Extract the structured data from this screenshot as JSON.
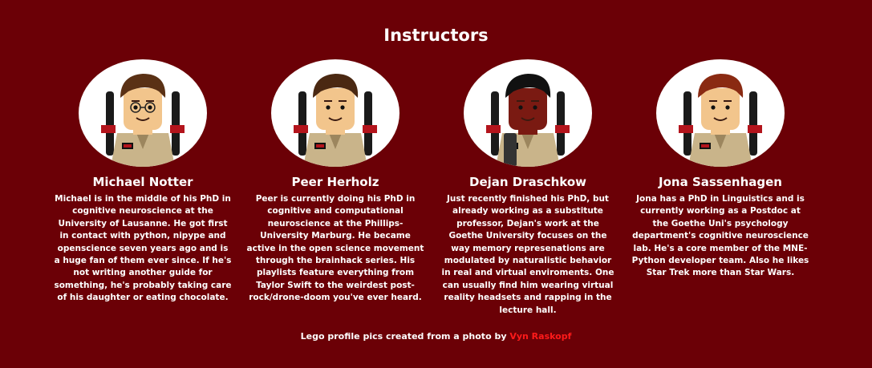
{
  "section": {
    "title": "Instructors"
  },
  "instructors": [
    {
      "name": "Michael Notter",
      "bio": "Michael is in the middle of his PhD in cognitive neuroscience at the University of Lausanne. He got first in contact with python, nipype and openscience seven years ago and is a huge fan of them ever since. If he's not writing another guide for something, he's probably taking care of his daughter or eating chocolate.",
      "avatar_icon": "lego-ghostbuster-glasses-avatar",
      "skin": "#f2c58c",
      "hair": "#5a3115"
    },
    {
      "name": "Peer Herholz",
      "bio": "Peer is currently doing his PhD in cognitive and computational neuroscience at the Phillips-University Marburg. He became active in the open science movement through the brainhack series. His playlists feature everything from Taylor Swift to the weirdest post-rock/drone-doom you've ever heard.",
      "avatar_icon": "lego-ghostbuster-avatar",
      "skin": "#f2c58c",
      "hair": "#4a2812"
    },
    {
      "name": "Dejan Draschkow",
      "bio": "Just recently finished his PhD, but already working as a substitute professor, Dejan's work at the Goethe University focuses on the way memory represenations are modulated by naturalistic behavior in real and virtual enviroments. One can usually find him wearing virtual reality headsets and rapping in the lecture hall.",
      "avatar_icon": "lego-ghostbuster-dark-avatar",
      "skin": "#7a1a12",
      "hair": "#111111"
    },
    {
      "name": "Jona Sassenhagen",
      "bio": "Jona has a PhD in Linguistics and is currently working as a Postdoc at the Goethe Uni's psychology department's cognitive neuroscience lab. He's a core member of the MNE-Python developer team. Also he likes Star Trek more than Star Wars.",
      "avatar_icon": "lego-ghostbuster-redhead-avatar",
      "skin": "#f2c58c",
      "hair": "#8a2a12"
    }
  ],
  "credit": {
    "prefix": "Lego profile pics created from a photo by ",
    "link_text": "Vyn Raskopf"
  }
}
